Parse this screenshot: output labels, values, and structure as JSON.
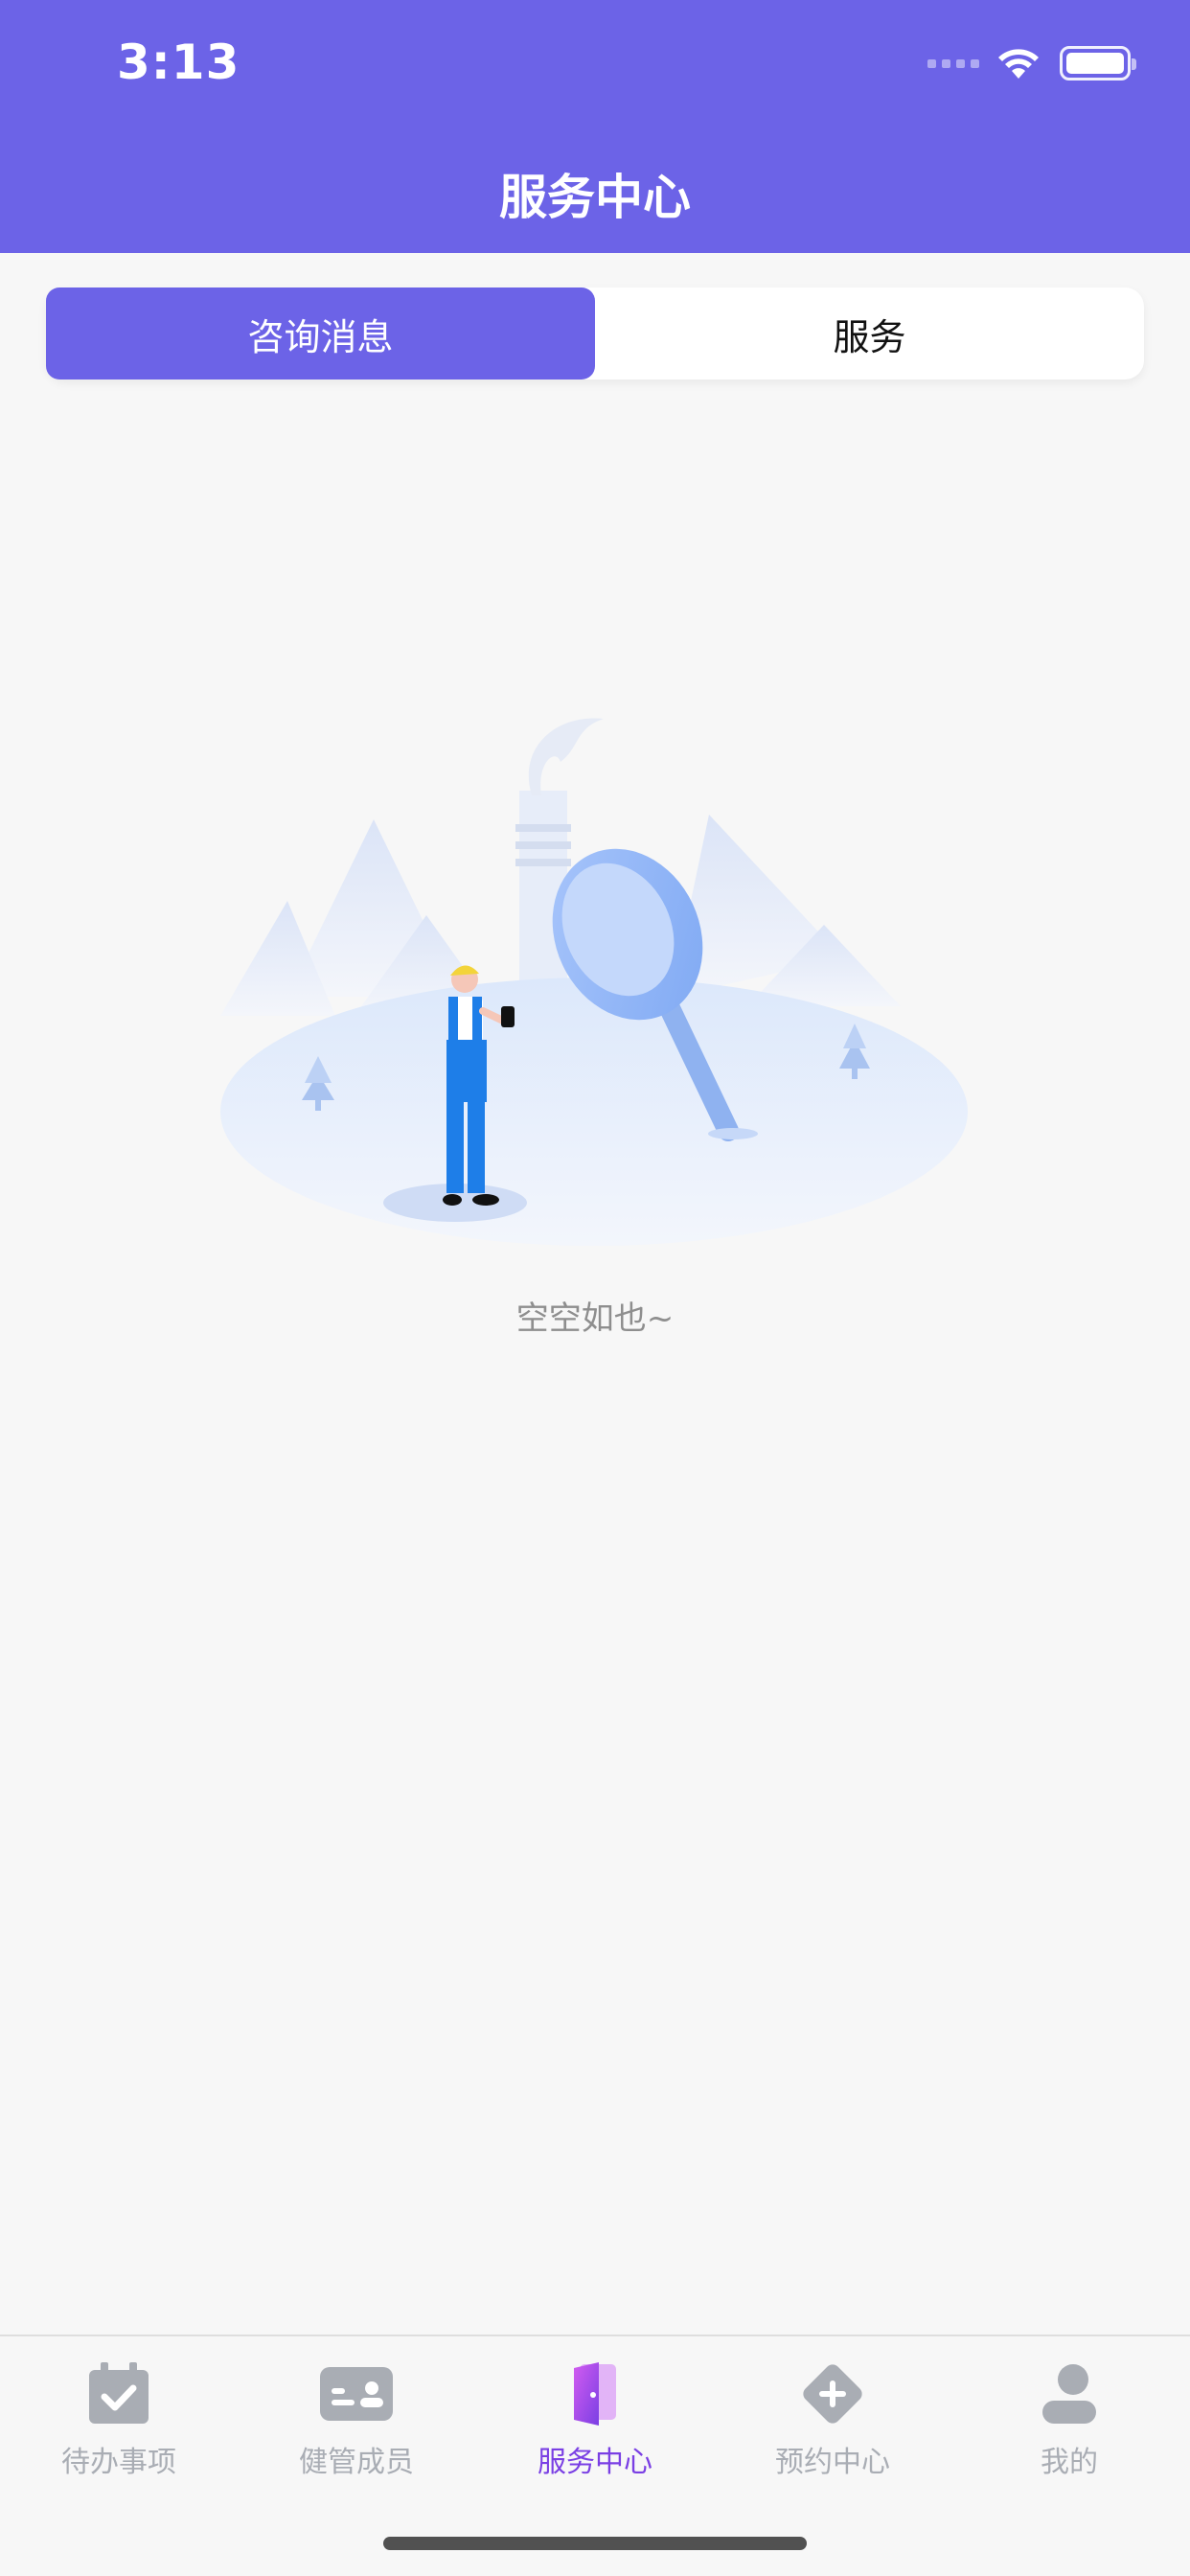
{
  "status_bar": {
    "time": "3:13"
  },
  "header": {
    "title": "服务中心"
  },
  "segment": {
    "tabs": [
      {
        "label": "咨询消息",
        "active": true
      },
      {
        "label": "服务",
        "active": false
      }
    ]
  },
  "empty_state": {
    "message": "空空如也~"
  },
  "tabbar": {
    "items": [
      {
        "label": "待办事项",
        "icon": "calendar-check-icon",
        "active": false
      },
      {
        "label": "健管成员",
        "icon": "id-card-icon",
        "active": false
      },
      {
        "label": "服务中心",
        "icon": "door-icon",
        "active": true
      },
      {
        "label": "预约中心",
        "icon": "plus-diamond-icon",
        "active": false
      },
      {
        "label": "我的",
        "icon": "user-icon",
        "active": false
      }
    ]
  },
  "colors": {
    "primary": "#6c63e7",
    "active_tab": "#7a3fe4",
    "inactive_tab": "#a9adb4",
    "background": "#f7f7f7"
  }
}
